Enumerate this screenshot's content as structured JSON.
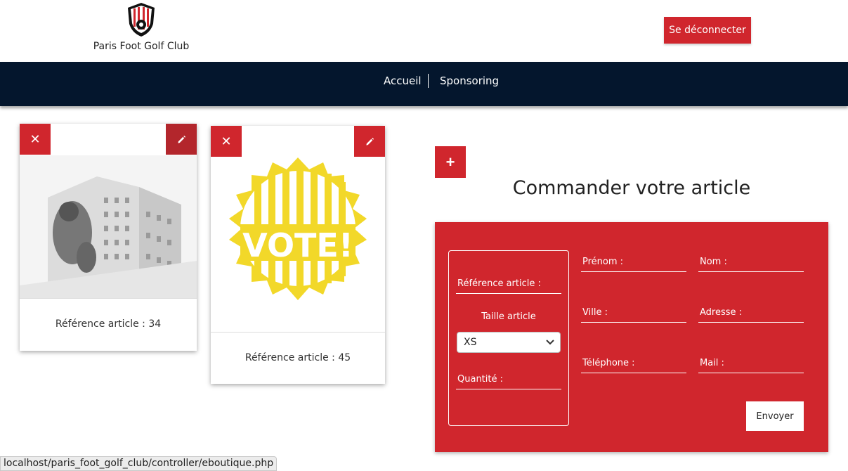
{
  "header": {
    "club_name": "Paris Foot Golf Club",
    "logout_label": "Se déconnecter"
  },
  "nav": {
    "items": [
      "Accueil",
      "Sponsoring"
    ]
  },
  "cards": [
    {
      "caption": "Référence article : 34",
      "image": "building-mural-photo"
    },
    {
      "caption": "Référence article : 45",
      "image": "vote-badge"
    }
  ],
  "icons": {
    "delete": "×",
    "edit": "pencil-icon",
    "add": "+"
  },
  "form": {
    "title": "Commander votre article",
    "reference_label": "Référence article :",
    "size_label": "Taille article",
    "size_selected": "XS",
    "quantity_label": "Quantité :",
    "firstname_label": "Prénom :",
    "lastname_label": "Nom :",
    "city_label": "Ville :",
    "address_label": "Adresse :",
    "phone_label": "Téléphone :",
    "mail_label": "Mail :",
    "submit_label": "Envoyer"
  },
  "status_bar": {
    "url": "localhost/paris_foot_golf_club/controller/eboutique.php"
  },
  "colors": {
    "accent": "#d0262d",
    "navbar": "#04162d"
  }
}
